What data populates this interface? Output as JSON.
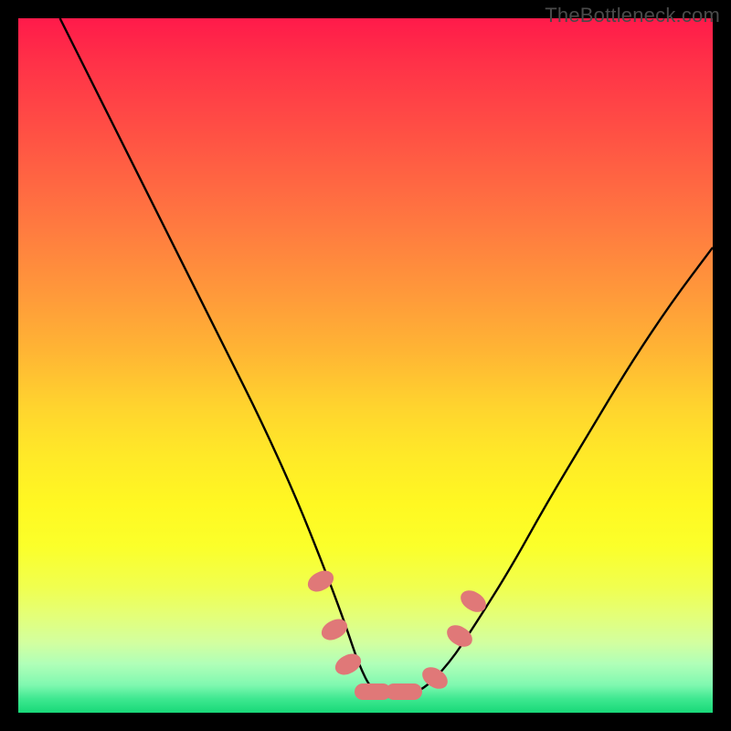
{
  "watermark": "TheBottleneck.com",
  "chart_data": {
    "type": "line",
    "title": "",
    "xlabel": "",
    "ylabel": "",
    "xlim": [
      0,
      100
    ],
    "ylim": [
      0,
      100
    ],
    "grid": false,
    "legend": false,
    "series": [
      {
        "name": "curve",
        "x": [
          6,
          10,
          15,
          20,
          25,
          30,
          35,
          40,
          44,
          47,
          49,
          51,
          54,
          58,
          62,
          66,
          71,
          76,
          82,
          88,
          94,
          100
        ],
        "y": [
          100,
          92,
          82,
          72,
          62,
          52,
          42,
          31,
          21,
          13,
          7,
          3,
          2,
          3,
          7,
          13,
          21,
          30,
          40,
          50,
          59,
          67
        ]
      }
    ],
    "markers": [
      {
        "x": 43.5,
        "y": 19,
        "shape": "oval"
      },
      {
        "x": 45.5,
        "y": 12,
        "shape": "oval"
      },
      {
        "x": 47.5,
        "y": 7,
        "shape": "oval"
      },
      {
        "x": 51.0,
        "y": 3,
        "shape": "flat"
      },
      {
        "x": 55.5,
        "y": 3,
        "shape": "flat"
      },
      {
        "x": 60.0,
        "y": 5,
        "shape": "oval"
      },
      {
        "x": 63.5,
        "y": 11,
        "shape": "oval"
      },
      {
        "x": 65.5,
        "y": 16,
        "shape": "oval"
      }
    ],
    "background_gradient": {
      "top": "#ff1a4a",
      "mid": "#ffe928",
      "bottom": "#18d878"
    }
  }
}
